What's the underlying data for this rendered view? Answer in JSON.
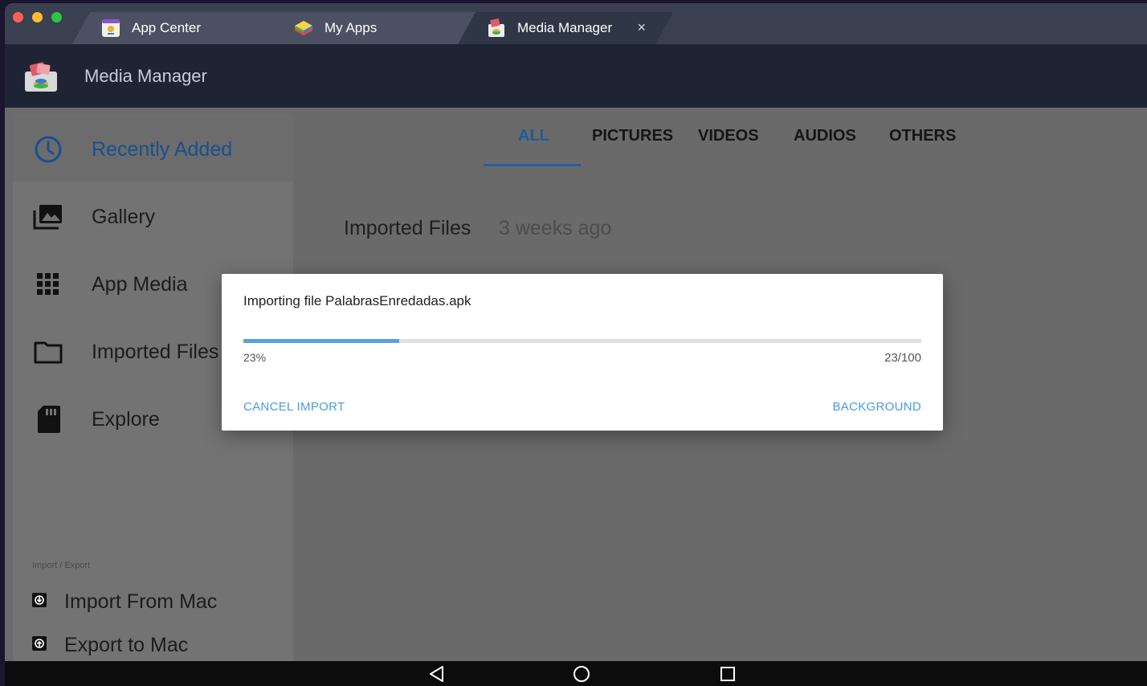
{
  "window": {
    "tabs": [
      {
        "label": "App Center",
        "icon": "app-center-icon",
        "active": false
      },
      {
        "label": "My Apps",
        "icon": "my-apps-icon",
        "active": false
      },
      {
        "label": "Media Manager",
        "icon": "media-manager-icon",
        "active": true,
        "close": "×"
      }
    ]
  },
  "header": {
    "title": "Media Manager"
  },
  "sidebar": {
    "items": [
      {
        "label": "Recently Added",
        "icon": "clock-icon",
        "selected": true
      },
      {
        "label": "Gallery",
        "icon": "gallery-icon",
        "selected": false
      },
      {
        "label": "App Media",
        "icon": "grid-icon",
        "selected": false
      },
      {
        "label": "Imported Files",
        "icon": "folder-icon",
        "selected": false
      },
      {
        "label": "Explore",
        "icon": "sd-card-icon",
        "selected": false
      }
    ],
    "section_caption": "Import / Export",
    "io_items": [
      {
        "label": "Import From Mac",
        "icon": "import-icon"
      },
      {
        "label": "Export to Mac",
        "icon": "export-icon"
      }
    ]
  },
  "filters": {
    "tabs": [
      "ALL",
      "PICTURES",
      "VIDEOS",
      "AUDIOS",
      "OTHERS"
    ],
    "active": "ALL"
  },
  "main": {
    "section_title": "Imported Files",
    "section_time": "3 weeks ago"
  },
  "dialog": {
    "message": "Importing file PalabrasEnredadas.apk",
    "progress_fraction": 0.23,
    "percent_label": "23%",
    "count_label": "23/100",
    "cancel_label": "CANCEL IMPORT",
    "background_label": "BACKGROUND"
  },
  "navbar": {
    "buttons": [
      "back-icon",
      "home-icon",
      "recents-icon"
    ]
  },
  "colors": {
    "accent": "#4b9be3",
    "progress": "#5aa1e3",
    "selected_text": "#17508f",
    "header_bg": "#1e2434"
  }
}
